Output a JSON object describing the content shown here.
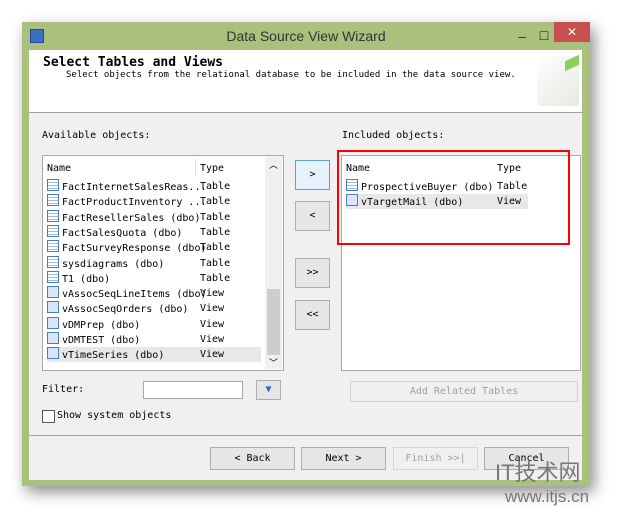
{
  "window": {
    "title": "Data Source View Wizard",
    "minimize": "–",
    "maximize": "☐",
    "close": "✕"
  },
  "header": {
    "title": "Select Tables and Views",
    "subtitle": "Select objects from the relational database to be included in the data source view."
  },
  "available": {
    "label": "Available objects:",
    "col_name": "Name",
    "col_type": "Type",
    "rows": [
      {
        "name": "FactInternetSalesReas...",
        "type": "Table",
        "icon": "table-icon"
      },
      {
        "name": "FactProductInventory ...",
        "type": "Table",
        "icon": "table-icon"
      },
      {
        "name": "FactResellerSales (dbo)",
        "type": "Table",
        "icon": "table-icon"
      },
      {
        "name": "FactSalesQuota (dbo)",
        "type": "Table",
        "icon": "table-icon"
      },
      {
        "name": "FactSurveyResponse (dbo)",
        "type": "Table",
        "icon": "table-icon"
      },
      {
        "name": "sysdiagrams (dbo)",
        "type": "Table",
        "icon": "table-icon"
      },
      {
        "name": "T1 (dbo)",
        "type": "Table",
        "icon": "table-icon"
      },
      {
        "name": "vAssocSeqLineItems (dbo)",
        "type": "View",
        "icon": "view-icon"
      },
      {
        "name": "vAssocSeqOrders (dbo)",
        "type": "View",
        "icon": "view-icon"
      },
      {
        "name": "vDMPrep (dbo)",
        "type": "View",
        "icon": "view-icon"
      },
      {
        "name": "vDMTEST (dbo)",
        "type": "View",
        "icon": "view-icon"
      },
      {
        "name": "vTimeSeries (dbo)",
        "type": "View",
        "icon": "view-icon",
        "selected": true
      }
    ]
  },
  "included": {
    "label": "Included objects:",
    "col_name": "Name",
    "col_type": "Type",
    "rows": [
      {
        "name": "ProspectiveBuyer (dbo)",
        "type": "Table",
        "icon": "table-icon"
      },
      {
        "name": "vTargetMail (dbo)",
        "type": "View",
        "icon": "view-icon",
        "selected": true
      }
    ]
  },
  "move": {
    "add": ">",
    "remove": "<",
    "add_all": ">>",
    "remove_all": "<<"
  },
  "filter": {
    "label": "Filter:",
    "value": "",
    "button_icon": "funnel-icon"
  },
  "show_system": {
    "label": "Show system objects",
    "checked": false
  },
  "add_related": "Add Related Tables",
  "footer": {
    "back": "< Back",
    "next": "Next >",
    "finish": "Finish >>|",
    "cancel": "Cancel"
  },
  "watermark": {
    "logo": "IT技术网",
    "url": "www.itjs.cn"
  },
  "colors": {
    "titlebar": "#a9c17c",
    "close": "#c7504f",
    "highlight": "#ff0000"
  }
}
